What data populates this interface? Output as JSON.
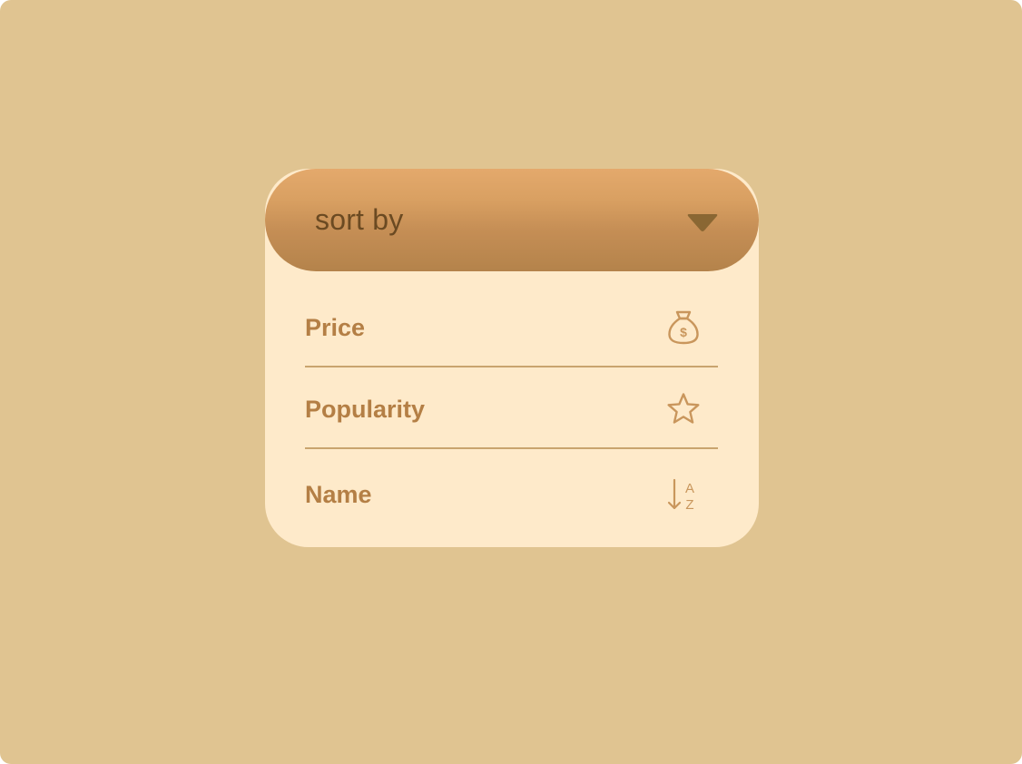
{
  "dropdown": {
    "trigger_label": "sort by",
    "options": [
      {
        "label": "Price",
        "icon": "money-bag-icon"
      },
      {
        "label": "Popularity",
        "icon": "star-icon"
      },
      {
        "label": "Name",
        "icon": "sort-az-icon"
      }
    ],
    "sort_icon_letters": {
      "top": "A",
      "bottom": "Z"
    },
    "price_icon_symbol": "$"
  },
  "colors": {
    "background": "#e0c491",
    "panel": "#feeaca",
    "trigger_top": "#e4a96c",
    "trigger_bottom": "#b4834b",
    "label_text": "#b47f45",
    "trigger_text": "#6b4a22",
    "caret": "#8a6733",
    "divider": "#c9a46e"
  }
}
